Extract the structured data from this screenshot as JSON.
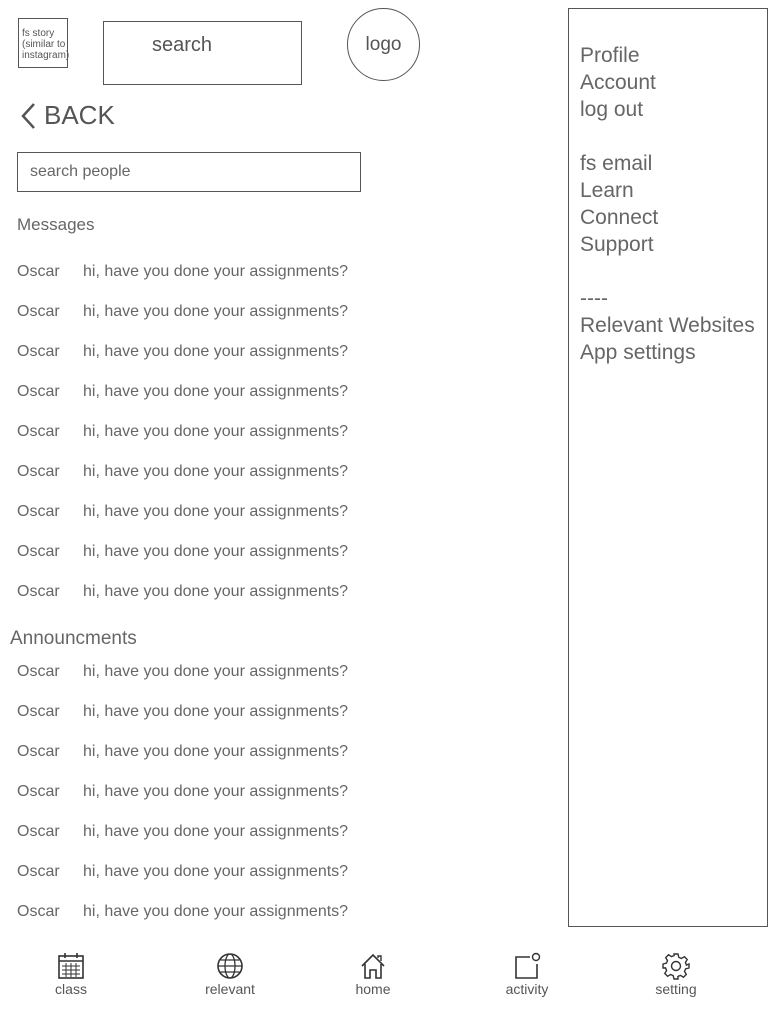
{
  "header": {
    "story_label": "fs story (similar to instagram)",
    "search_label": "search",
    "logo_label": "logo"
  },
  "back_label": "BACK",
  "search_people": {
    "placeholder": "search people"
  },
  "messages": {
    "title": "Messages",
    "items": [
      {
        "sender": "Oscar",
        "text": "hi, have you done your assignments?"
      },
      {
        "sender": "Oscar",
        "text": "hi, have you done your assignments?"
      },
      {
        "sender": "Oscar",
        "text": "hi, have you done your assignments?"
      },
      {
        "sender": "Oscar",
        "text": "hi, have you done your assignments?"
      },
      {
        "sender": "Oscar",
        "text": "hi, have you done your assignments?"
      },
      {
        "sender": "Oscar",
        "text": "hi, have you done your assignments?"
      },
      {
        "sender": "Oscar",
        "text": "hi, have you done your assignments?"
      },
      {
        "sender": "Oscar",
        "text": "hi, have you done your assignments?"
      },
      {
        "sender": "Oscar",
        "text": "hi, have you done your assignments?"
      }
    ]
  },
  "announcements": {
    "title": "Announcments",
    "items": [
      {
        "sender": "Oscar",
        "text": "hi, have you done your assignments?"
      },
      {
        "sender": "Oscar",
        "text": "hi, have you done your assignments?"
      },
      {
        "sender": "Oscar",
        "text": "hi, have you done your assignments?"
      },
      {
        "sender": "Oscar",
        "text": "hi, have you done your assignments?"
      },
      {
        "sender": "Oscar",
        "text": "hi, have you done your assignments?"
      },
      {
        "sender": "Oscar",
        "text": "hi, have you done your assignments?"
      },
      {
        "sender": "Oscar",
        "text": "hi, have you done your assignments?"
      }
    ]
  },
  "side_menu": {
    "items": [
      "Profile",
      "Account",
      "log out",
      "fs email",
      "Learn",
      "Connect",
      "Support",
      "----",
      "Relevant Websites",
      "App settings"
    ]
  },
  "bottom_nav": [
    {
      "label": "class",
      "icon": "calendar-icon"
    },
    {
      "label": "relevant",
      "icon": "globe-icon"
    },
    {
      "label": "home",
      "icon": "home-icon"
    },
    {
      "label": "activity",
      "icon": "notification-icon"
    },
    {
      "label": "setting",
      "icon": "gear-icon"
    }
  ],
  "colors": {
    "text": "#666666",
    "border": "#555555",
    "background": "#ffffff"
  }
}
